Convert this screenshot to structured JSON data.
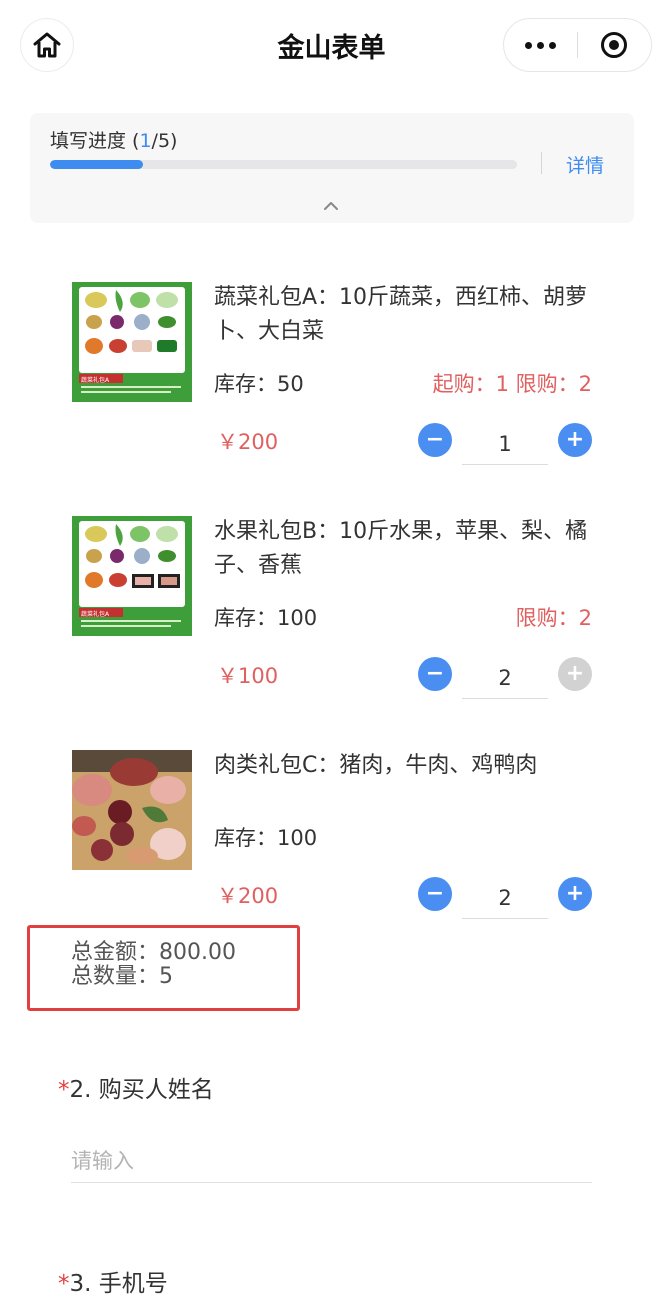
{
  "header": {
    "title": "金山表单",
    "home_icon": "home-icon",
    "more_icon": "more-dots-icon",
    "close_icon": "close-miniprogram-icon"
  },
  "progress": {
    "label_prefix": "填写进度 (",
    "current": "1",
    "label_suffix": "/5)",
    "fraction": 0.2,
    "detail_label": "详情"
  },
  "products": [
    {
      "name": "蔬菜礼包A：10斤蔬菜，西红柿、胡萝卜、大白菜",
      "stock": "库存：50",
      "limits": "起购：1 限购：2",
      "price": "￥200",
      "qty": "1",
      "plus_enabled": true,
      "image_caption": "蔬菜礼包A"
    },
    {
      "name": "水果礼包B：10斤水果，苹果、梨、橘子、香蕉",
      "stock": "库存：100",
      "limits": "限购：2",
      "price": "￥100",
      "qty": "2",
      "plus_enabled": false,
      "image_caption": "蔬菜礼包A"
    },
    {
      "name": "肉类礼包C：猪肉，牛肉、鸡鸭肉",
      "stock": "库存：100",
      "limits": "",
      "price": "￥200",
      "qty": "2",
      "plus_enabled": true
    }
  ],
  "totals": {
    "amount": "总金额：800.00",
    "count": "总数量：5"
  },
  "questions": [
    {
      "star": "*",
      "label": "2. 购买人姓名",
      "placeholder": "请输入"
    },
    {
      "star": "*",
      "label": "3. 手机号"
    }
  ],
  "colors": {
    "accent": "#3f8cf0",
    "price_red": "#e06060",
    "highlight_border": "#e24040"
  }
}
